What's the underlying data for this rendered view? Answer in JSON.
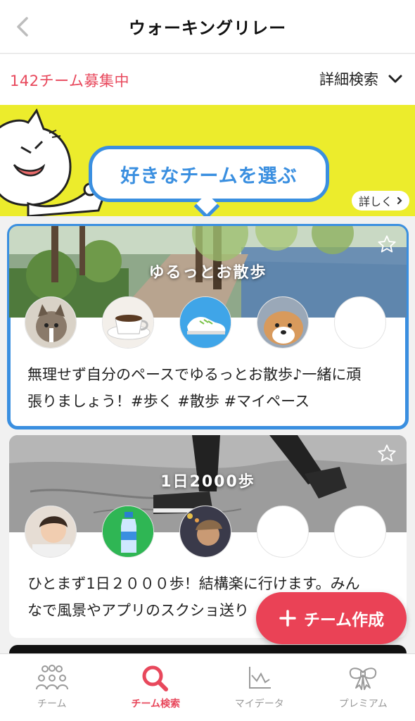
{
  "header": {
    "title": "ウォーキングリレー"
  },
  "subbar": {
    "recruit_text": "142チーム募集中",
    "detail_search_label": "詳細検索"
  },
  "banner": {
    "bubble_text": "好きなチームを選ぶ",
    "more_label": "詳しく"
  },
  "cards": [
    {
      "title": "ゆるっとお散歩",
      "description_line1": "無理せず自分のペースでゆるっとお散歩♪一緒に頑",
      "description_line2": "張りましょう！#歩く #散歩 #マイペース",
      "selected": true
    },
    {
      "title": "1日2000歩",
      "description_line1": "ひとまず1日２０００歩！結構楽に行けます。みん",
      "description_line2": "なで風景やアプリのスクショ送り"
    }
  ],
  "fab": {
    "label": "チーム作成"
  },
  "tabs": [
    {
      "label": "チーム",
      "icon": "team-icon",
      "active": false
    },
    {
      "label": "チーム検索",
      "icon": "search-icon",
      "active": true
    },
    {
      "label": "マイデータ",
      "icon": "chart-icon",
      "active": false
    },
    {
      "label": "プレミアム",
      "icon": "ribbon-icon",
      "active": false
    }
  ],
  "colors": {
    "accent_red": "#e8485c",
    "accent_blue": "#3a8fe0",
    "banner_yellow": "#ecec2c"
  }
}
